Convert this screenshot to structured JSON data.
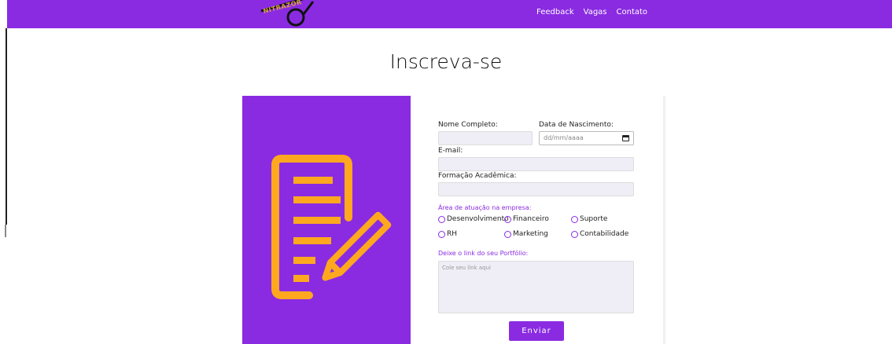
{
  "header": {
    "logo_text": "NITRAZOR",
    "nav": [
      "Feedback",
      "Vagas",
      "Contato"
    ],
    "bg_color": "#8a2be2"
  },
  "page": {
    "title": "Inscreva-se"
  },
  "form": {
    "name_label": "Nome Completo:",
    "birth_label": "Data de Nascimento:",
    "birth_placeholder": "dd/mm/aaaa",
    "email_label": "E-mail:",
    "education_label": "Formação Acadêmica:",
    "area_label": "Área de atuação na empresa:",
    "areas": [
      "Desenvolvimento",
      "Financeiro",
      "Suporte",
      "RH",
      "Marketing",
      "Contabilidade"
    ],
    "portfolio_label": "Deixe o link do seu Portfólio:",
    "portfolio_placeholder": "Cole seu link aqui",
    "submit_label": "Enviar"
  },
  "icons": {
    "form_illustration": "document-edit-icon",
    "date_picker": "calendar-icon"
  },
  "colors": {
    "accent": "#8a2be2",
    "illustration": "#ffa81f"
  }
}
